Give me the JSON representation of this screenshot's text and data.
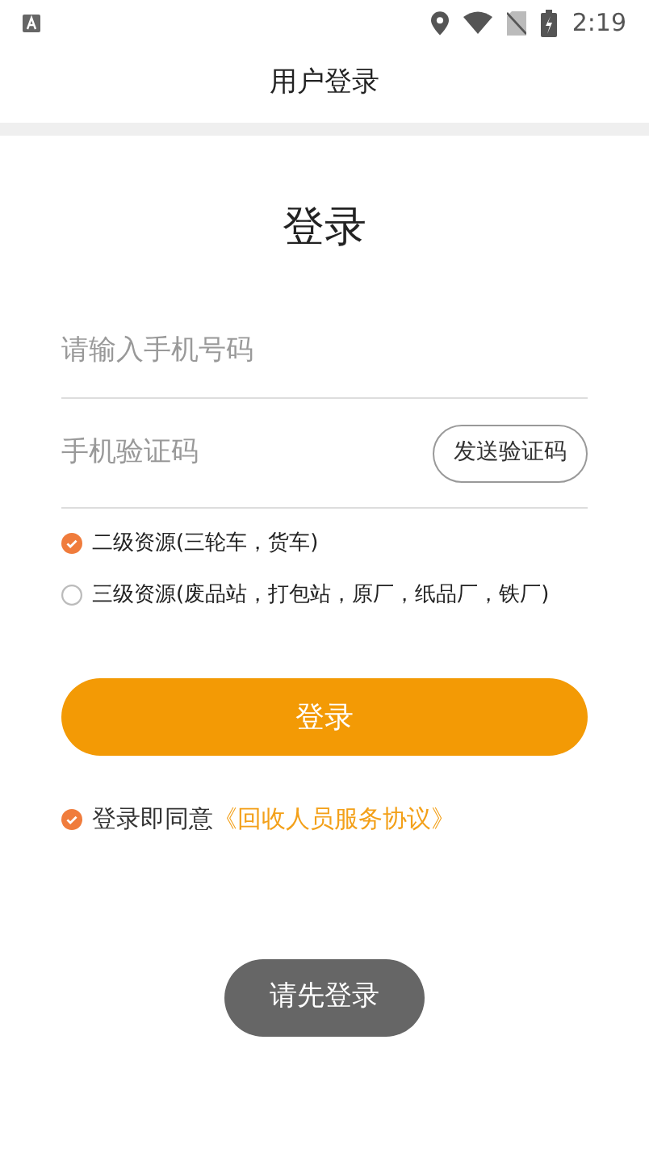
{
  "status_bar": {
    "time": "2:19"
  },
  "header": {
    "title": "用户登录"
  },
  "form": {
    "heading": "登录",
    "phone_field": {
      "placeholder": "请输入手机号码"
    },
    "code_field": {
      "placeholder": "手机验证码"
    },
    "send_code_button": "发送验证码",
    "resource_levels": [
      {
        "label": "二级资源(三轮车，货车)",
        "selected": true
      },
      {
        "label": "三级资源(废品站，打包站，原厂，纸品厂，铁厂)",
        "selected": false
      }
    ],
    "login_button": "登录",
    "agreement": {
      "checked": true,
      "text": "登录即同意",
      "link": "《回收人员服务协议》"
    }
  },
  "toast": "请先登录"
}
